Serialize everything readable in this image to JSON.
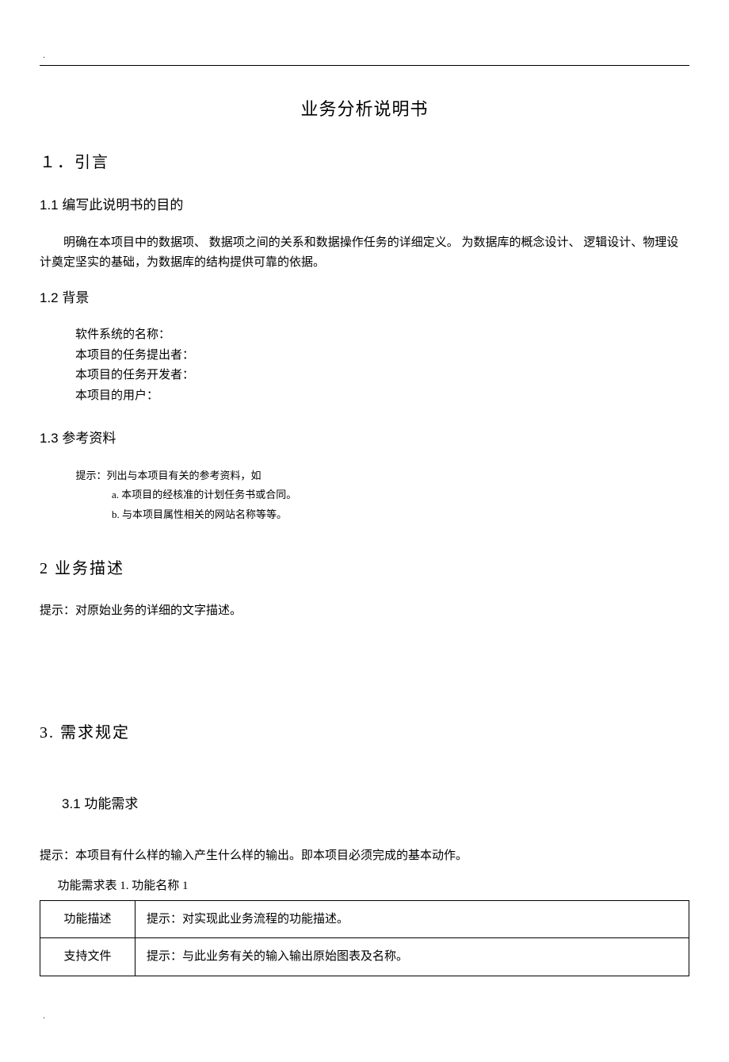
{
  "marker": ".",
  "title": "业务分析说明书",
  "s1": {
    "heading": "１．引言",
    "s11": {
      "heading": "1.1 编写此说明书的目的",
      "para": "明确在本项目中的数据项、 数据项之间的关系和数据操作任务的详细定义。 为数据库的概念设计、 逻辑设计、物理设计奠定坚实的基础，为数据库的结构提供可靠的依据。"
    },
    "s12": {
      "heading": "1.2   背景",
      "fields": {
        "a": "软件系统的名称：",
        "b": "本项目的任务提出者：",
        "c": "本项目的任务开发者：",
        "d": "本项目的用户："
      }
    },
    "s13": {
      "heading": "1.3 参考资料",
      "hint": "提示：列出与本项目有关的参考资料，如",
      "a": "a. 本项目的经核准的计划任务书或合同。",
      "b": "b. 与本项目属性相关的网站名称等等。"
    }
  },
  "s2": {
    "heading": "2 业务描述",
    "hint": "提示：对原始业务的详细的文字描述。"
  },
  "s3": {
    "heading": "3. 需求规定",
    "s31": {
      "heading": "3.1 功能需求",
      "hint": "提示：本项目有什么样的输入产生什么样的输出。即本项目必须完成的基本动作。",
      "table_caption": "功能需求表 1. 功能名称   1",
      "rows": {
        "r1": {
          "label": "功能描述",
          "value": "提示：对实现此业务流程的功能描述。"
        },
        "r2": {
          "label": "支持文件",
          "value": "提示：与此业务有关的输入输出原始图表及名称。"
        }
      }
    }
  }
}
